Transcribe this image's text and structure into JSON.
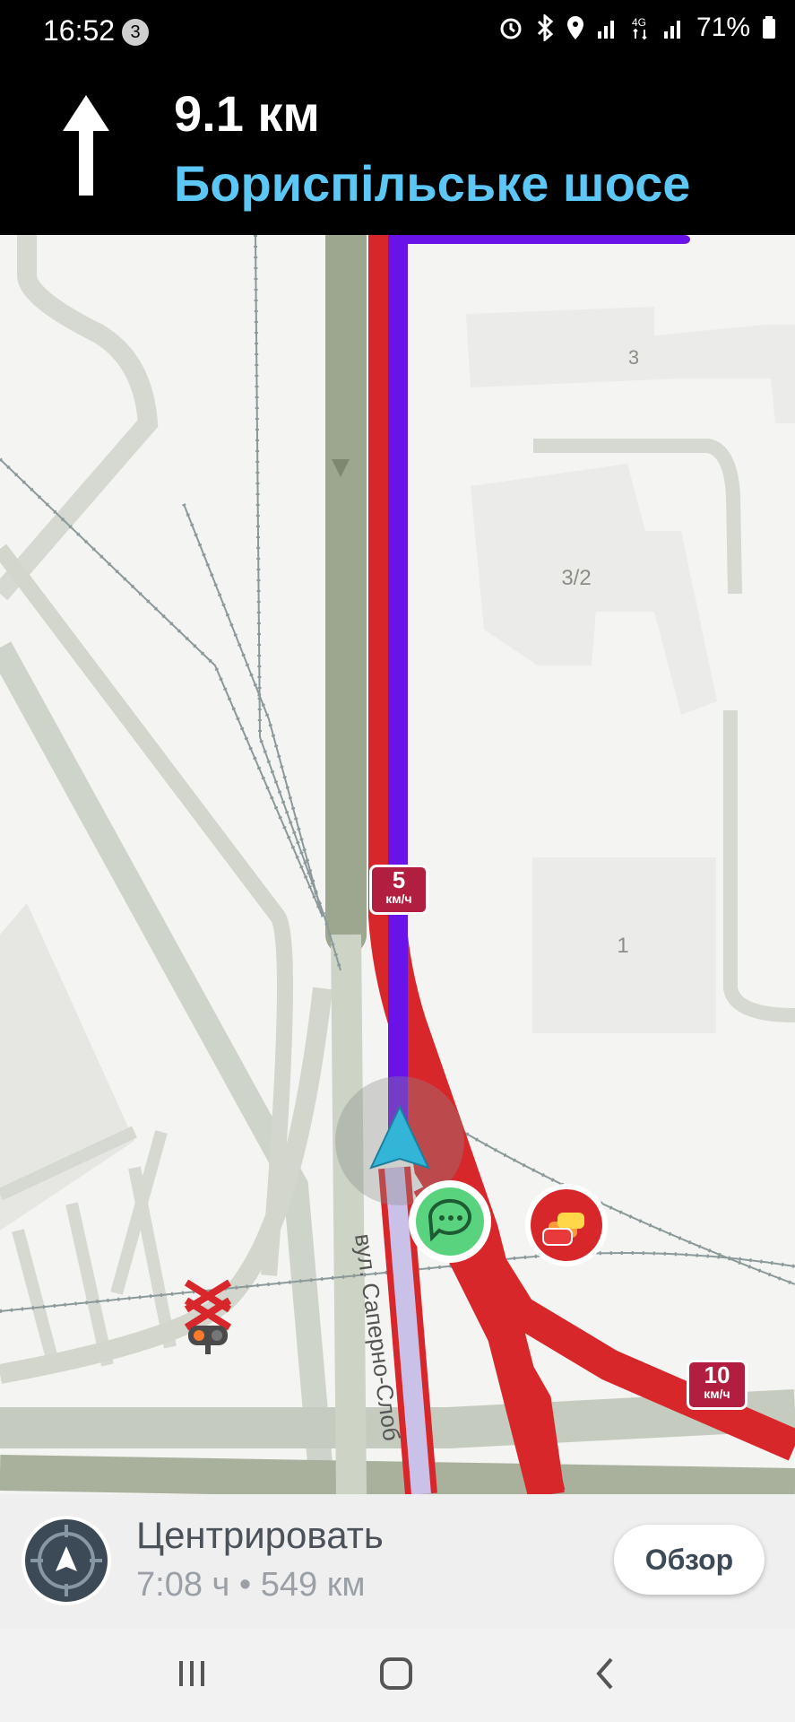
{
  "status_bar": {
    "time": "16:52",
    "notification_count": "3",
    "battery": "71%",
    "icons": [
      "alarm-icon",
      "bluetooth-icon",
      "location-icon",
      "signal-icon",
      "4g-icon",
      "signal-icon",
      "battery-icon"
    ]
  },
  "nav_banner": {
    "direction_icon": "straight-arrow-icon",
    "distance": "9.1 км",
    "street": "Бориспільське шосе"
  },
  "map": {
    "building_labels": [
      "3",
      "3/2",
      "1"
    ],
    "road_label": "вул. Саперно-Слоб",
    "speed_badges": [
      {
        "value": "5",
        "unit": "км/ч"
      },
      {
        "value": "10",
        "unit": "км/ч"
      }
    ],
    "colors": {
      "route": "#6a13e8",
      "traffic_jam": "#d8272b",
      "user_arrow": "#33b5d8"
    }
  },
  "bottom_panel": {
    "center_label": "Центрировать",
    "eta": "7:08 ч • 549 км",
    "overview_button": "Обзор"
  }
}
